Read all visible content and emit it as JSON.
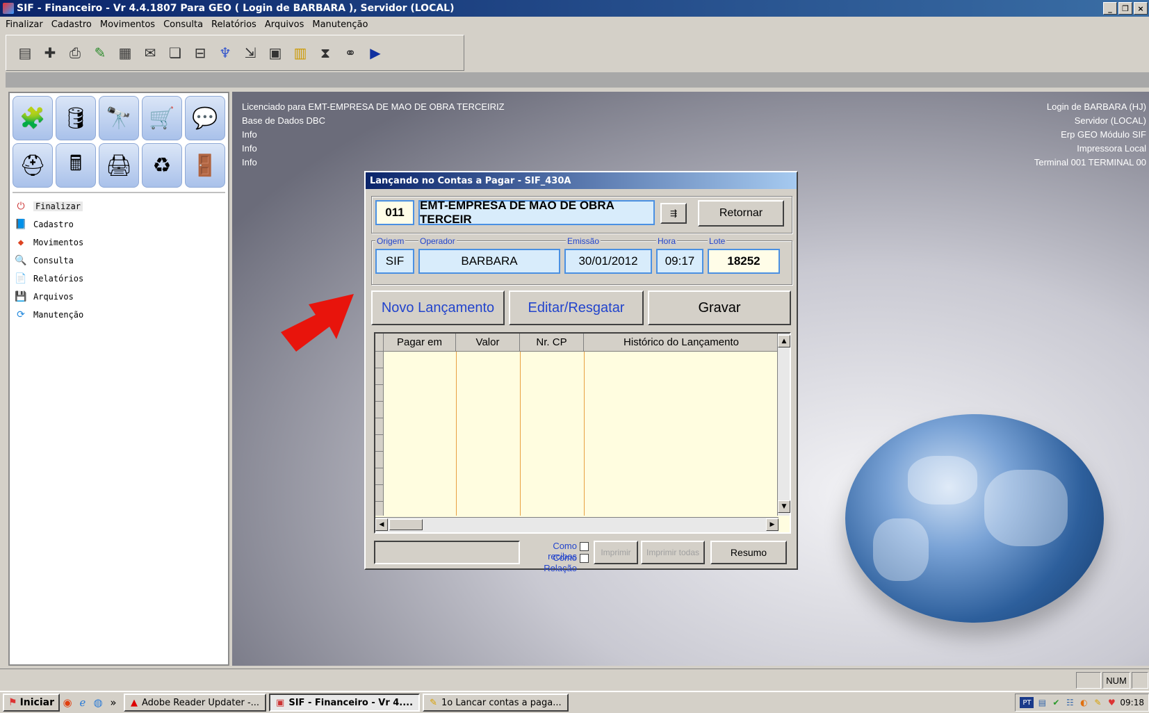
{
  "window": {
    "title": "SIF - Financeiro - Vr 4.4.1807 Para GEO  ( Login de BARBARA ), Servidor (LOCAL)"
  },
  "menu": [
    "Finalizar",
    "Cadastro",
    "Movimentos",
    "Consulta",
    "Relatórios",
    "Arquivos",
    "Manutenção"
  ],
  "toolbar_icons": [
    "properties-icon",
    "add-icon",
    "print-icon",
    "edit-icon",
    "grid-icon",
    "mail-icon",
    "copy-icon",
    "network-icon",
    "tree-icon",
    "export-icon",
    "clipboard-icon",
    "chart-icon",
    "hourglass-icon",
    "binoculars-icon",
    "play-icon"
  ],
  "left_panel": {
    "items": [
      {
        "label": "Finalizar",
        "icon": "power-icon"
      },
      {
        "label": "Cadastro",
        "icon": "book-icon"
      },
      {
        "label": "Movimentos",
        "icon": "shapes-icon"
      },
      {
        "label": "Consulta",
        "icon": "magnifier-icon"
      },
      {
        "label": "Relatórios",
        "icon": "report-icon"
      },
      {
        "label": "Arquivos",
        "icon": "floppy-icon"
      },
      {
        "label": "Manutenção",
        "icon": "refresh-icon"
      }
    ]
  },
  "info_left": [
    "Licenciado para EMT-EMPRESA DE MAO DE OBRA TERCEIRIZ",
    "Base de Dados DBC",
    "Info",
    "Info",
    "Info"
  ],
  "info_right": [
    "Login de BARBARA (HJ)",
    "Servidor (LOCAL)",
    "Erp GEO Módulo SIF",
    "Impressora Local",
    "Terminal 001 TERMINAL 00"
  ],
  "dialog": {
    "title": "Lançando no Contas a Pagar - SIF_430A",
    "company_code": "011",
    "company_name": "EMT-EMPRESA DE MAO DE OBRA TERCEIR",
    "retornar": "Retornar",
    "labels": {
      "origem": "Origem",
      "operador": "Operador",
      "emissao": "Emissão",
      "hora": "Hora",
      "lote": "Lote"
    },
    "values": {
      "origem": "SIF",
      "operador": "BARBARA",
      "emissao": "30/01/2012",
      "hora": "09:17",
      "lote": "18252"
    },
    "buttons": {
      "novo": "Novo Lançamento",
      "editar": "Editar/Resgatar",
      "gravar": "Gravar"
    },
    "grid_columns": [
      "Pagar em",
      "Valor",
      "Nr. CP",
      "Histórico do Lançamento"
    ],
    "como_recibos": "Como recibos",
    "como_relacao": "Como Relação",
    "imprimir": "Imprimir",
    "imprimir_todas": "Imprimir todas",
    "resumo": "Resumo"
  },
  "status": {
    "num": "NUM"
  },
  "taskbar": {
    "start": "Iniciar",
    "tasks": [
      "Adobe Reader Updater -...",
      "SIF - Financeiro - Vr 4....",
      "1o Lancar contas a paga..."
    ],
    "lang": "PT",
    "clock": "09:18"
  }
}
